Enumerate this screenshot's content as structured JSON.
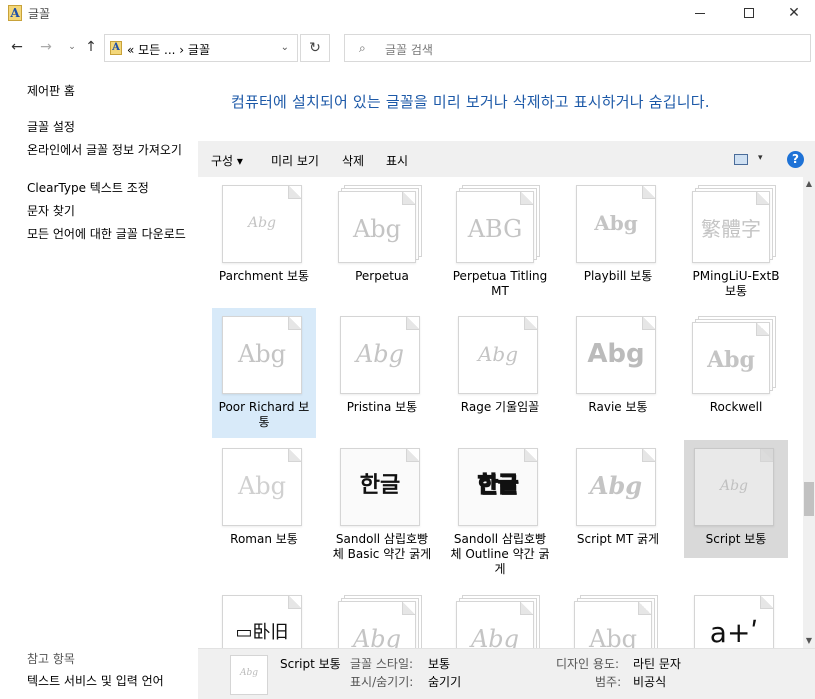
{
  "window": {
    "title": "글꼴",
    "app_icon": "font-folder-icon",
    "min_icon": "minimize-icon",
    "max_icon": "maximize-icon",
    "close_icon": "close-icon"
  },
  "nav": {
    "back_icon": "←",
    "forward_icon": "→",
    "recent_icon": "⌄",
    "up_icon": "↑",
    "address_text": "« 모든 ...  ›  글꼴",
    "address_chevron": "⌄",
    "refresh_icon": "↻",
    "search_icon": "⌕",
    "search_placeholder": "글꼴 검색"
  },
  "sidebar": {
    "links": [
      {
        "label": "제어판 홈"
      },
      {
        "label": "글꼴 설정"
      },
      {
        "label": "온라인에서 글꼴 정보 가져오기"
      },
      {
        "label": "ClearType 텍스트 조정"
      },
      {
        "label": "문자 찾기"
      },
      {
        "label": "모든 언어에 대한 글꼴 다운로드"
      }
    ],
    "see_also": "참고 항목",
    "see_also_link": "텍스트 서비스 및 입력 언어"
  },
  "main": {
    "headline": "컴퓨터에 설치되어 있는 글꼴을 미리 보거나 삭제하고 표시하거나 숨깁니다."
  },
  "toolbar": {
    "organize": "구성 ▾",
    "preview": "미리 보기",
    "delete": "삭제",
    "show": "표시",
    "view_arrow": "▾",
    "help": "?"
  },
  "fonts": [
    {
      "name": "Parchment 보통",
      "glyph": "Abg"
    },
    {
      "name": "Perpetua",
      "glyph": "Abg"
    },
    {
      "name": "Perpetua Titling MT",
      "glyph": "ABG"
    },
    {
      "name": "Playbill 보통",
      "glyph": "Abg"
    },
    {
      "name": "PMingLiU-ExtB 보통",
      "glyph": "繁體字"
    },
    {
      "name": "Poor Richard 보통",
      "glyph": "Abg"
    },
    {
      "name": "Pristina 보통",
      "glyph": "Abg"
    },
    {
      "name": "Rage 기울임꼴",
      "glyph": "Abg"
    },
    {
      "name": "Ravie 보통",
      "glyph": "Abg"
    },
    {
      "name": "Rockwell",
      "glyph": "Abg"
    },
    {
      "name": "Roman 보통",
      "glyph": "Abg"
    },
    {
      "name": "Sandoll 삼립호빵체 Basic 약간 굵게",
      "glyph": "한글"
    },
    {
      "name": "Sandoll 삼립호빵체 Outline 약간 굵게",
      "glyph": "한글"
    },
    {
      "name": "Script MT 굵게",
      "glyph": "Abg"
    },
    {
      "name": "Script 보통",
      "glyph": "Abg"
    },
    {
      "name": "",
      "glyph": "▭卧旧"
    },
    {
      "name": "",
      "glyph": "Abg"
    },
    {
      "name": "",
      "glyph": "Abg"
    },
    {
      "name": "",
      "glyph": "Abg"
    },
    {
      "name": "",
      "glyph": "a+ʹ"
    }
  ],
  "details": {
    "thumb_glyph": "Abg",
    "name": "Script 보통",
    "style_key": "글꼴 스타일:",
    "style_val": "보통",
    "vis_key": "표시/숨기기:",
    "vis_val": "숨기기",
    "design_key": "디자인 용도:",
    "design_val": "라틴 문자",
    "cat_key": "범주:",
    "cat_val": "비공식"
  },
  "scrollbar": {
    "up": "▲",
    "down": "▼"
  }
}
